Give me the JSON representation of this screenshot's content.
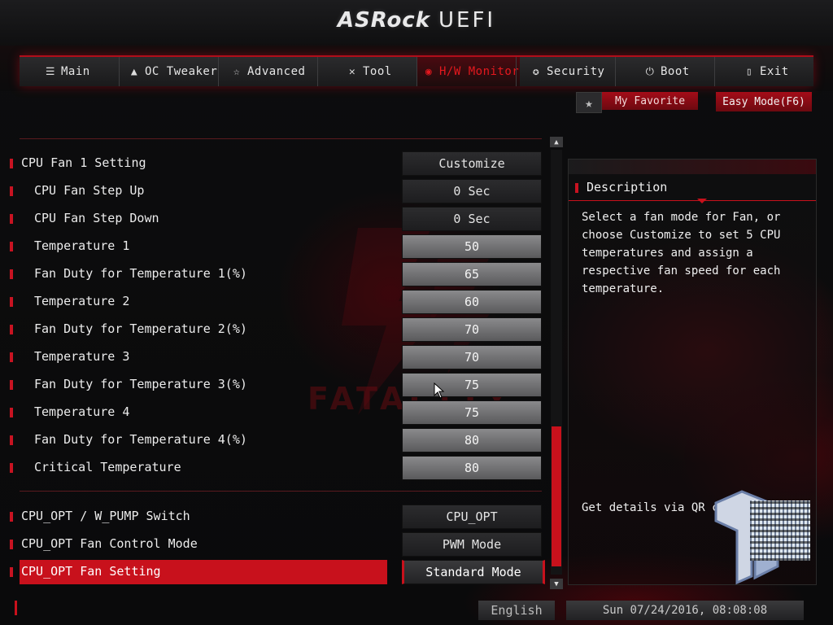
{
  "header": {
    "brand": "ASRock",
    "product": "UEFI"
  },
  "tabs": [
    {
      "label": "Main",
      "icon": "list-icon"
    },
    {
      "label": "OC Tweaker",
      "icon": "rocket-icon"
    },
    {
      "label": "Advanced",
      "icon": "star-cursor-icon"
    },
    {
      "label": "Tool",
      "icon": "tools-icon"
    },
    {
      "label": "H/W Monitor",
      "icon": "monitor-gauge-icon",
      "active": true
    },
    {
      "label": "Security",
      "icon": "shield-icon"
    },
    {
      "label": "Boot",
      "icon": "power-icon"
    },
    {
      "label": "Exit",
      "icon": "exit-door-icon"
    }
  ],
  "favorite": {
    "label": "My Favorite"
  },
  "easy_mode": {
    "label": "Easy Mode(F6)"
  },
  "settings": [
    {
      "label": "CPU Fan 1 Setting",
      "value": "Customize"
    },
    {
      "label": "CPU Fan Step Up",
      "value": "0 Sec"
    },
    {
      "label": "CPU Fan Step Down",
      "value": "0 Sec"
    },
    {
      "label": "Temperature 1",
      "value": "50"
    },
    {
      "label": "Fan Duty for Temperature 1(%)",
      "value": "65"
    },
    {
      "label": "Temperature 2",
      "value": "60"
    },
    {
      "label": "Fan Duty for Temperature 2(%)",
      "value": "70"
    },
    {
      "label": "Temperature 3",
      "value": "70"
    },
    {
      "label": "Fan Duty for Temperature 3(%)",
      "value": "75"
    },
    {
      "label": "Temperature 4",
      "value": "75"
    },
    {
      "label": "Fan Duty for Temperature 4(%)",
      "value": "80"
    },
    {
      "label": "Critical Temperature",
      "value": "80"
    },
    {
      "label": "CPU_OPT / W_PUMP Switch",
      "value": "CPU_OPT"
    },
    {
      "label": "CPU_OPT Fan Control Mode",
      "value": "PWM Mode"
    },
    {
      "label": "CPU_OPT Fan Setting",
      "value": "Standard Mode"
    }
  ],
  "watermark": "FATAL1TY",
  "description": {
    "title": "Description",
    "body": "Select a fan mode for Fan, or\nchoose Customize to set 5 CPU\ntemperatures and assign a\nrespective fan speed for each\ntemperature.",
    "qr_text": "Get details via QR code"
  },
  "footer": {
    "language": "English",
    "datetime": "Sun 07/24/2016, 08:08:08"
  },
  "colors": {
    "accent": "#c8111c",
    "background": "#0b0b0c"
  }
}
